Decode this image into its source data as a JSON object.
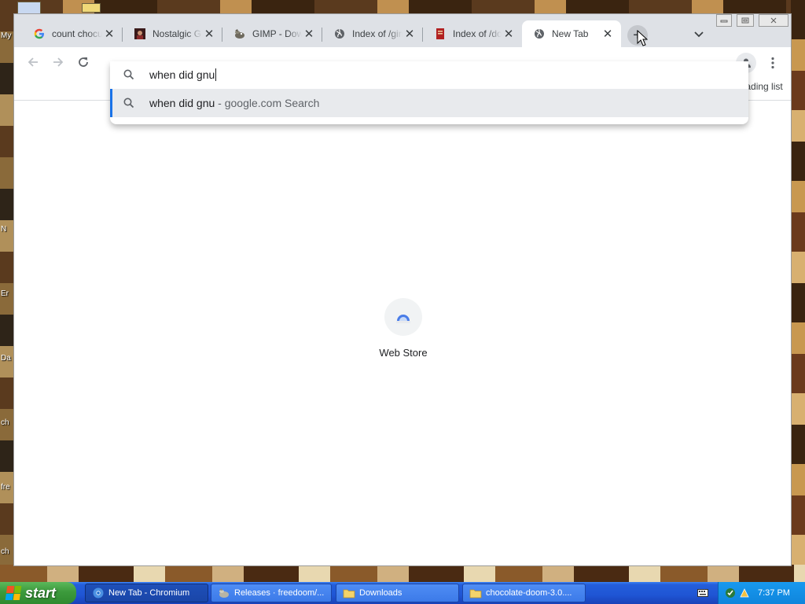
{
  "desktop": {
    "icon_labels": [
      "My",
      "N",
      "Er",
      "Da",
      "ch",
      "fre",
      "ch"
    ]
  },
  "browser": {
    "tabs": [
      {
        "title": "count chocul",
        "icon": "google-g-icon"
      },
      {
        "title": "Nostalgic Gif",
        "icon": "photo-favicon-icon"
      },
      {
        "title": "GIMP - Down",
        "icon": "gimp-wilber-icon"
      },
      {
        "title": "Index of /gim",
        "icon": "globe-icon"
      },
      {
        "title": "Index of /do",
        "icon": "document-favicon-icon"
      },
      {
        "title": "New Tab",
        "icon": "globe-icon",
        "active": true
      }
    ],
    "tab_close_glyph": "✕",
    "new_tab_glyph": "+",
    "omnibox": {
      "input_text": "when did gnu",
      "suggestion_main": "when did gnu",
      "suggestion_sub": " - google.com Search"
    },
    "reading_list_label": "Reading list",
    "shortcut": {
      "label": "Web Store"
    },
    "colors": {
      "accent": "#1a73e8",
      "tabstrip": "#dee1e6"
    }
  },
  "taskbar": {
    "start_label": "start",
    "tasks": [
      {
        "label": "New Tab - Chromium",
        "icon": "chromium-icon",
        "active": true
      },
      {
        "label": "Releases · freedoom/...",
        "icon": "gimp-wilber-icon",
        "active": false
      },
      {
        "label": "Downloads",
        "icon": "folder-icon",
        "active": false
      },
      {
        "label": "chocolate-doom-3.0....",
        "icon": "folder-icon",
        "active": false
      }
    ],
    "clock": "7:37 PM"
  }
}
